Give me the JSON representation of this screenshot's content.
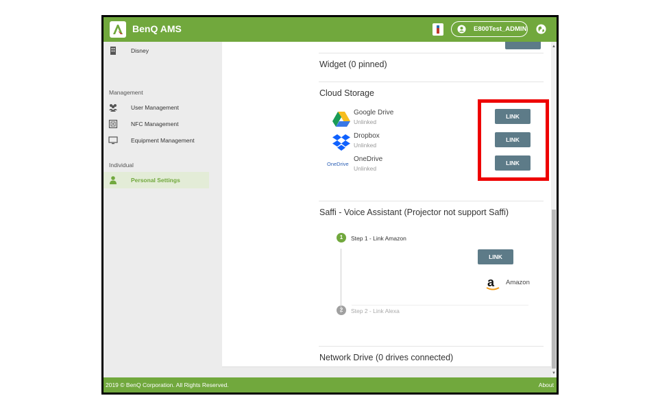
{
  "app": {
    "title": "BenQ AMS",
    "user": "E800Test_ADMIN"
  },
  "sidebar": {
    "items_top": [
      {
        "label": "Disney",
        "icon": "building-icon"
      }
    ],
    "management": {
      "label": "Management",
      "items": [
        {
          "label": "User Management",
          "icon": "users-icon"
        },
        {
          "label": "NFC Management",
          "icon": "nfc-icon"
        },
        {
          "label": "Equipment Management",
          "icon": "monitor-icon"
        }
      ]
    },
    "individual": {
      "label": "Individual",
      "items": [
        {
          "label": "Personal Settings",
          "icon": "person-icon",
          "active": true
        }
      ]
    }
  },
  "main": {
    "widget_title": "Widget (0 pinned)",
    "cloud_storage": {
      "title": "Cloud Storage",
      "services": [
        {
          "name": "Google Drive",
          "status": "Unlinked",
          "button": "LINK",
          "icon": "google-drive-icon"
        },
        {
          "name": "Dropbox",
          "status": "Unlinked",
          "button": "LINK",
          "icon": "dropbox-icon"
        },
        {
          "name": "OneDrive",
          "status": "Unlinked",
          "button": "LINK",
          "icon": "onedrive-icon"
        }
      ]
    },
    "saffi": {
      "title": "Saffi - Voice Assistant (Projector not support Saffi)",
      "steps": [
        {
          "number": "1",
          "label": "Step 1 - Link Amazon",
          "active": true
        },
        {
          "number": "2",
          "label": "Step 2 - Link Alexa",
          "active": false
        }
      ],
      "amazon": {
        "name": "Amazon",
        "button": "LINK",
        "logo_letter": "a"
      }
    },
    "network_drive": {
      "title": "Network Drive (0 drives connected)"
    }
  },
  "footer": {
    "copyright": "2019 © BenQ Corporation. All Rights Reserved.",
    "about": "About"
  },
  "colors": {
    "brand_green": "#71a83d",
    "button_slate": "#5d7b88",
    "highlight_red": "#ee0000"
  }
}
